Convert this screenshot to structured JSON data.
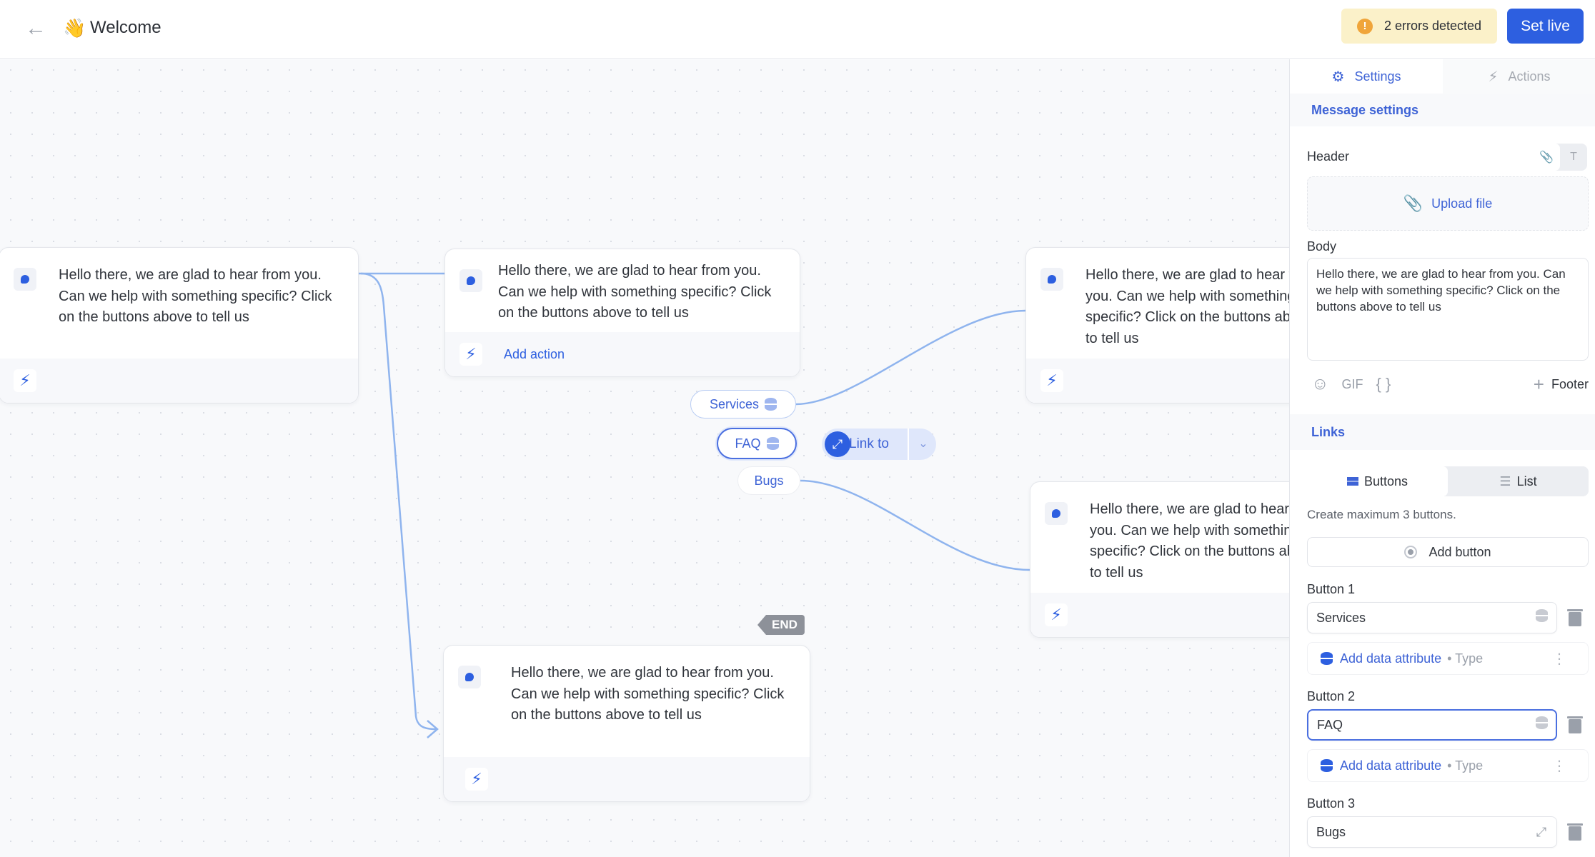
{
  "header": {
    "back_icon": "arrow-left-icon",
    "title_emoji": "👋",
    "title": "Welcome",
    "errors_label": "2 errors detected",
    "errors_icon": "!",
    "set_live_label": "Set live",
    "colors": {
      "accent": "#2d5fe0",
      "warning_bg": "#fbf1c9",
      "warning_icon": "#f0a53a"
    }
  },
  "canvas": {
    "nodes": [
      {
        "text": "Hello there, we are glad to hear from you. Can we help with something specific? Click on the buttons above to tell us",
        "action_label": ""
      },
      {
        "text": "Hello there, we are glad to hear from you. Can we help with something specific? Click on the buttons above to tell us",
        "action_label": "Add action"
      },
      {
        "text": "Hello there, we are glad to hear from you. Can we help with something specific? Click on the buttons above to tell us",
        "action_label": ""
      },
      {
        "text": "Hello there, we are glad to hear from you. Can we help with something specific? Click on the buttons above to tell us",
        "action_label": ""
      },
      {
        "text": "Hello there, we are glad to hear from you. Can we help with something specific? Click on the buttons above to tell us",
        "action_label": ""
      }
    ],
    "buttons": [
      {
        "label": "Services",
        "has_data_icon": true
      },
      {
        "label": "FAQ",
        "has_data_icon": true,
        "selected": true
      },
      {
        "label": "Bugs",
        "has_data_icon": false
      }
    ],
    "link_to_label": "Link to",
    "end_label": "END"
  },
  "panel": {
    "tabs": [
      {
        "label": "Settings",
        "icon": "gear-icon",
        "active": true
      },
      {
        "label": "Actions",
        "icon": "bolt-icon",
        "active": false
      }
    ],
    "message_settings_heading": "Message settings",
    "header_label": "Header",
    "header_toggle": {
      "attach": "📎",
      "text": "T"
    },
    "upload_label": "Upload file",
    "body_label": "Body",
    "body_value": "Hello there, we are glad to hear from you. Can we help with something specific? Click on the buttons above to tell us",
    "tools": {
      "emoji": "☺",
      "gif": "GIF",
      "variables": "{ }",
      "footer": "Footer",
      "plus": "+"
    },
    "links_heading": "Links",
    "link_modes": [
      {
        "label": "Buttons",
        "active": true
      },
      {
        "label": "List",
        "active": false
      }
    ],
    "hint": "Create maximum 3 buttons.",
    "add_button_label": "Add button",
    "buttons": [
      {
        "label": "Button 1",
        "value": "Services",
        "icon": "database-icon",
        "attr_label": "Add data attribute",
        "attr_type": "Type"
      },
      {
        "label": "Button 2",
        "value": "FAQ",
        "icon": "database-icon",
        "attr_label": "Add data attribute",
        "attr_type": "Type",
        "focused": true
      },
      {
        "label": "Button 3",
        "value": "Bugs",
        "icon": "link-icon"
      }
    ]
  }
}
